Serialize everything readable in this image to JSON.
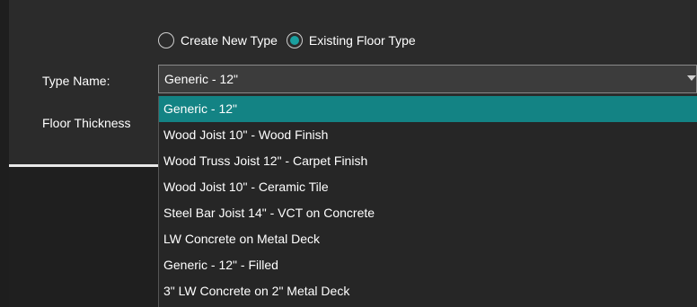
{
  "form": {
    "mode_options": [
      {
        "label": "Create New Type",
        "checked": false
      },
      {
        "label": "Existing Floor Type",
        "checked": true
      }
    ],
    "type_name_label": "Type Name:",
    "floor_thickness_label": "Floor Thickness",
    "type_name_value": "Generic - 12\""
  },
  "dropdown": {
    "selected_index": 0,
    "items": [
      "Generic - 12\"",
      "Wood Joist 10\" - Wood Finish",
      "Wood Truss  Joist 12\" - Carpet Finish",
      "Wood Joist 10\" - Ceramic Tile",
      "Steel Bar Joist 14\" - VCT on Concrete",
      "LW Concrete on Metal Deck",
      "Generic - 12\" - Filled",
      "3\" LW Concrete on 2\" Metal Deck"
    ]
  },
  "colors": {
    "accent": "#1aa0a0",
    "selected_row": "#138384",
    "background": "#2b2b2b"
  }
}
